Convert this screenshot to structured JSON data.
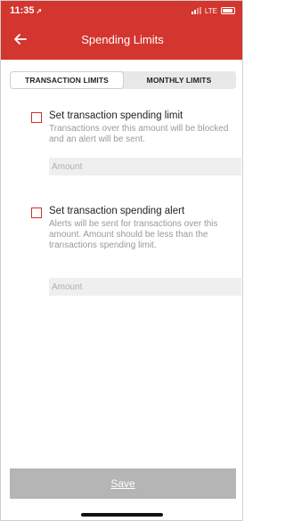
{
  "status_bar": {
    "time": "11:35",
    "network": "LTE"
  },
  "nav": {
    "title": "Spending Limits"
  },
  "tabs": [
    {
      "label": "TRANSACTION LIMITS",
      "selected": true
    },
    {
      "label": "MONTHLY LIMITS",
      "selected": false
    }
  ],
  "options": [
    {
      "title": "Set transaction spending limit",
      "description": "Transactions over this amount will be blocked and an alert will be sent.",
      "checked": false,
      "amount_placeholder": "Amount"
    },
    {
      "title": "Set transaction spending alert",
      "description": "Alerts will be sent for transactions over this amount.  Amount should be less than the transactions spending limit.",
      "checked": false,
      "amount_placeholder": "Amount"
    }
  ],
  "footer": {
    "save_label": "Save"
  },
  "colors": {
    "brand_red": "#d3352f",
    "checkbox_border": "#c9302c",
    "save_disabled": "#b5b5b5"
  }
}
